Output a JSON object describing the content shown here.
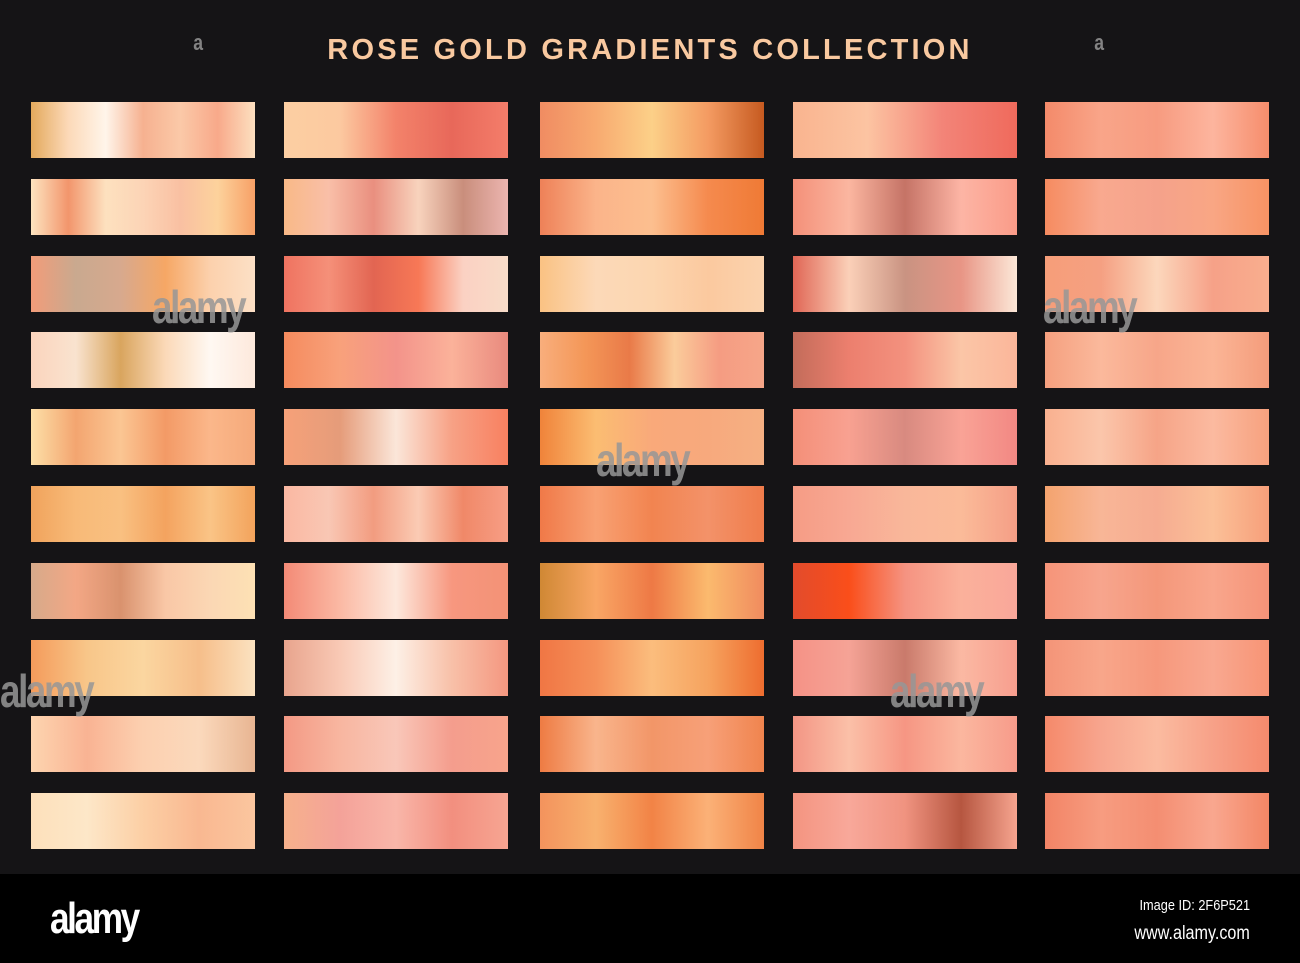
{
  "title": "ROSE GOLD GRADIENTS COLLECTION",
  "background_color": "#151416",
  "title_color": "#f9c9a0",
  "watermark": {
    "text": "alamy",
    "small": "a"
  },
  "footer": {
    "logo": "alamy",
    "image_id": "Image ID: 2F6P521",
    "site": "www.alamy.com"
  },
  "swatches": [
    [
      [
        "#e3a95c",
        "#fcd9b8",
        "#fff5ea",
        "#f6b190",
        "#fbc9a8",
        "#f8a98a",
        "#fde0c0"
      ],
      [
        "#fde4c0",
        "#f2956c",
        "#fde1bf",
        "#fcd4b6",
        "#f9c0a2",
        "#fdd29c",
        "#f7a066"
      ],
      [
        "#f29c79",
        "#c9a98f",
        "#d7a98e",
        "#f6a765",
        "#fcd1ad",
        "#fce0c6"
      ],
      [
        "#fbd4bd",
        "#f9e3cf",
        "#d9a55e",
        "#fbd9b8",
        "#fff8f2",
        "#fde9dc"
      ],
      [
        "#fde0a8",
        "#f3a570",
        "#fbc693",
        "#f39a66",
        "#fbb78a",
        "#f5a97a"
      ],
      [
        "#f0a35c",
        "#f8ba78",
        "#f9c081",
        "#f4a35f",
        "#fac486",
        "#f3a35c"
      ],
      [
        "#d6aa8a",
        "#f3a785",
        "#d9926e",
        "#f9c7a6",
        "#fbd7b4",
        "#fde1b4"
      ],
      [
        "#f49b5b",
        "#f8c689",
        "#fbd6a0",
        "#f6be8a",
        "#fbe2c0"
      ],
      [
        "#fdd5b0",
        "#f9b393",
        "#fcd0b0",
        "#fbd9bc",
        "#e8b592"
      ],
      [
        "#fde0bb",
        "#fde7c8",
        "#fccfa5",
        "#f9b891",
        "#fbc69f"
      ]
    ],
    [
      [
        "#fccfa2",
        "#fcc9a0",
        "#f3826a",
        "#e8685a",
        "#f47d6a"
      ],
      [
        "#f9b987",
        "#f9bfa8",
        "#e98f7f",
        "#f8d3bd",
        "#c98e7c",
        "#ecb5b0"
      ],
      [
        "#ef7360",
        "#f59079",
        "#e26552",
        "#f77856",
        "#fbd1c3",
        "#f8dcc8"
      ],
      [
        "#f58b5e",
        "#f8a17b",
        "#f3938a",
        "#fbb29a",
        "#e98a7e"
      ],
      [
        "#f6a179",
        "#e59c7a",
        "#fbe6d9",
        "#f7a185",
        "#f88060"
      ],
      [
        "#fab8a2",
        "#f9c7b4",
        "#f29c80",
        "#fbcbb4",
        "#f08868",
        "#f79e85"
      ],
      [
        "#f38a76",
        "#fbb9a4",
        "#fde8dc",
        "#f7977f",
        "#f39276"
      ],
      [
        "#e8a48d",
        "#f9c9b5",
        "#fdf0e6",
        "#f8c0a8",
        "#f49780"
      ],
      [
        "#f39984",
        "#f8b6a0",
        "#f9c7b9",
        "#f49d8d",
        "#f8a48c"
      ],
      [
        "#f6b18c",
        "#f4a299",
        "#f9b6a9",
        "#f28f7f",
        "#f7a592"
      ]
    ],
    [
      [
        "#f08c62",
        "#f8aa70",
        "#fcd088",
        "#f49b62",
        "#c65a20"
      ],
      [
        "#ee8158",
        "#fbb48a",
        "#fcbf8f",
        "#f58a4e",
        "#ef7a35"
      ],
      [
        "#fac283",
        "#fcd9b8",
        "#fcd6b0",
        "#fbc99f",
        "#fbd3ae"
      ],
      [
        "#f8ae7c",
        "#f49758",
        "#e97a48",
        "#fbcc9b",
        "#f59c82",
        "#f6a689"
      ],
      [
        "#f0833a",
        "#fbbd72",
        "#f9a97a",
        "#f7a97d",
        "#f6b083"
      ],
      [
        "#f07948",
        "#f8a173",
        "#f28450",
        "#f39269",
        "#f07c4b"
      ],
      [
        "#d08834",
        "#f9a665",
        "#ee7945",
        "#fbba6e",
        "#f08b5e"
      ],
      [
        "#f07644",
        "#f59059",
        "#fbbd7d",
        "#f6a35f",
        "#ee6d2f"
      ],
      [
        "#ee7b43",
        "#f9b58c",
        "#f29668",
        "#f7a078",
        "#f0844e"
      ],
      [
        "#f3935d",
        "#f8b16e",
        "#f28346",
        "#fbb177",
        "#f08447"
      ]
    ],
    [
      [
        "#f9b48f",
        "#fcc4a2",
        "#f38478",
        "#ef6a5c"
      ],
      [
        "#f49079",
        "#fbb6a0",
        "#c57366",
        "#fdb5a5",
        "#fa9b88"
      ],
      [
        "#e06655",
        "#fbd0b8",
        "#c99382",
        "#e89585",
        "#fce8d8"
      ],
      [
        "#c36c5a",
        "#ec7f6e",
        "#f3917e",
        "#fbc6a7",
        "#fbb69a"
      ],
      [
        "#f48f78",
        "#f8a191",
        "#d88a80",
        "#f9a396",
        "#f28883"
      ],
      [
        "#f59c85",
        "#f8a893",
        "#f9b79a",
        "#fbbb99",
        "#f59e86"
      ],
      [
        "#e24b2c",
        "#fa4e1a",
        "#f59381",
        "#fbb19b",
        "#f9a79a"
      ],
      [
        "#f59286",
        "#f5a396",
        "#c97a6b",
        "#fbb9a3",
        "#f79e8e"
      ],
      [
        "#f39584",
        "#fbc0a8",
        "#f69683",
        "#fbb79f",
        "#f79b8a"
      ],
      [
        "#f49480",
        "#f8a89a",
        "#f09380",
        "#b65640",
        "#f6a48f"
      ]
    ],
    [
      [
        "#f48a6a",
        "#f9a589",
        "#f79b80",
        "#fdb59e",
        "#f68d6c"
      ],
      [
        "#f58b60",
        "#f9a98f",
        "#f5a28b",
        "#f9a684",
        "#f79364"
      ],
      [
        "#f69e79",
        "#f5a082",
        "#fcd7bc",
        "#f6a188",
        "#f9ae8e"
      ],
      [
        "#f5a07f",
        "#fbb99c",
        "#f7a689",
        "#fbb596",
        "#f49c7b"
      ],
      [
        "#f9b08f",
        "#fbc6ab",
        "#f6a487",
        "#fbbaa0",
        "#f7a17e"
      ],
      [
        "#f4a36e",
        "#f8b697",
        "#f6ac91",
        "#fbc098",
        "#f79f7a"
      ],
      [
        "#f69479",
        "#f7a58d",
        "#f4977a",
        "#f9a68c",
        "#f59378"
      ],
      [
        "#f49478",
        "#f8a68a",
        "#f6987c",
        "#f9a890",
        "#f79475"
      ],
      [
        "#f5896a",
        "#f7a58e",
        "#fbbba0",
        "#f7a188",
        "#f58a6d"
      ],
      [
        "#f28466",
        "#f79c80",
        "#f48e72",
        "#f9a78f",
        "#f38665"
      ]
    ]
  ]
}
